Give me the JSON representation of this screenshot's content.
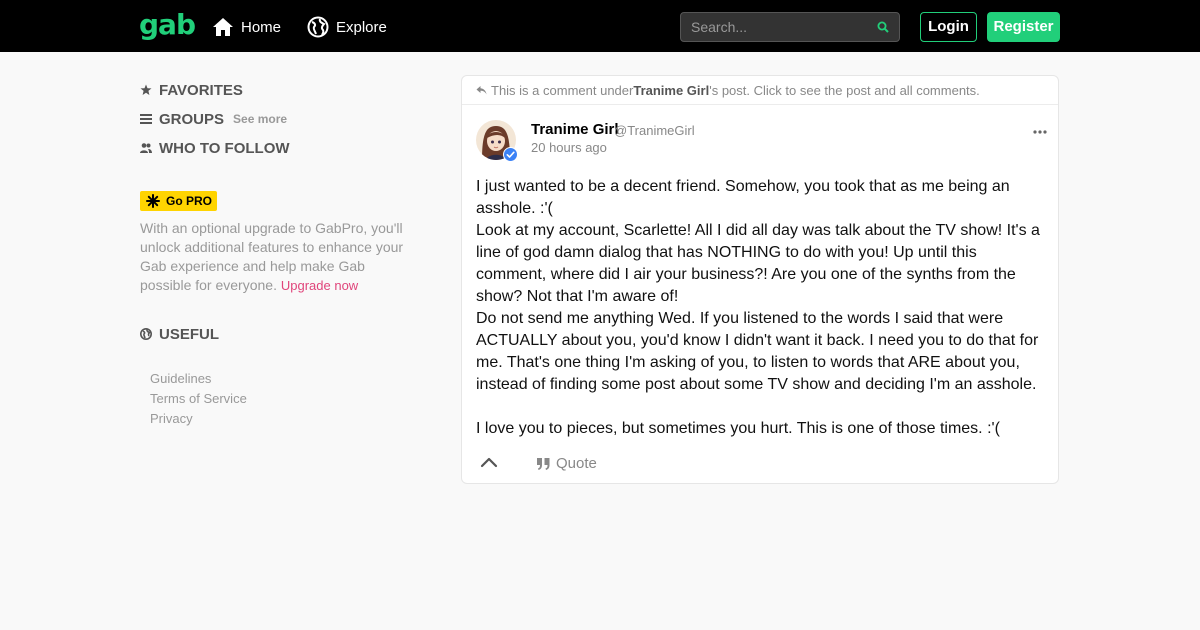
{
  "colors": {
    "brand": "#21cf7a",
    "pro": "#ffd400",
    "link_pink": "#e0457b",
    "verified": "#3b82f6"
  },
  "topbar": {
    "logo": "gab",
    "nav": [
      {
        "label": "Home",
        "icon": "home-icon"
      },
      {
        "label": "Explore",
        "icon": "globe-icon"
      }
    ],
    "search": {
      "placeholder": "Search...",
      "icon": "search-icon"
    },
    "login_label": "Login",
    "register_label": "Register"
  },
  "sidebar": {
    "favorites": {
      "label": "FAVORITES",
      "icon": "star-icon"
    },
    "groups": {
      "label": "GROUPS",
      "see_more": "See more",
      "icon": "list-icon"
    },
    "who_to_follow": {
      "label": "WHO TO FOLLOW",
      "icon": "users-icon"
    },
    "pro": {
      "badge": "Go PRO",
      "icon": "asterisk-icon",
      "description": "With an optional upgrade to GabPro, you'll unlock additional features to enhance your Gab experience and help make Gab possible for everyone.",
      "upgrade_link": "Upgrade now"
    },
    "useful": {
      "label": "USEFUL",
      "icon": "globe-icon"
    },
    "links": [
      "Guidelines",
      "Terms of Service",
      "Privacy"
    ]
  },
  "post": {
    "comment_note": {
      "prefix": "This is a comment under ",
      "author": "Tranime Girl",
      "suffix": "'s post. Click to see the post and all comments."
    },
    "author": "Tranime Girl",
    "handle": "@TranimeGirl",
    "time": "20 hours ago",
    "body": [
      "I just wanted to be a decent friend. Somehow, you took that as me being an asshole. :'(",
      "Look at my account, Scarlette! All I did all day was talk about the TV show! It's a line of god damn dialog that has NOTHING to do with you! Up until this comment, where did I air your business?! Are you one of the synths from the show? Not that I'm aware of!",
      "Do not send me anything Wed. If you listened to the words I said that were ACTUALLY about you, you'd know I didn't want it back. I need you to do that for me. That's one thing I'm asking of you, to listen to words that ARE about you, instead of finding some post about some TV show and deciding I'm an asshole.",
      "",
      "I love you to pieces, but sometimes you hurt. This is one of those times. :'("
    ],
    "actions": {
      "upvote_icon": "chevron-up-icon",
      "quote_label": "Quote",
      "quote_icon": "quote-icon"
    }
  }
}
